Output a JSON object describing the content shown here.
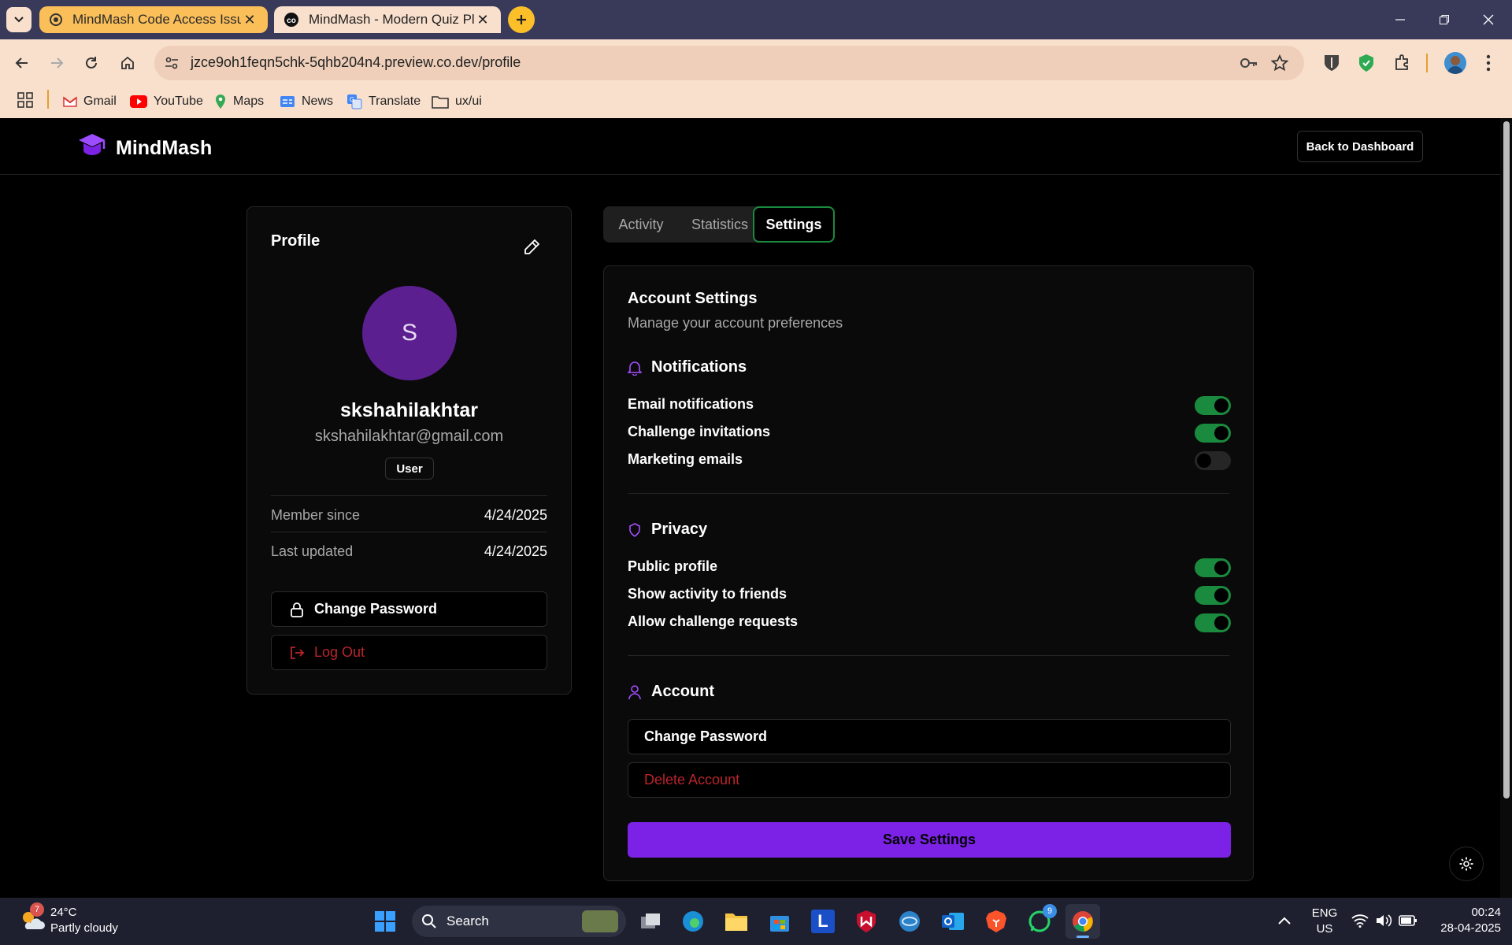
{
  "browser": {
    "tabs": [
      {
        "title": "MindMash Code Access Issue",
        "active": false
      },
      {
        "title": "MindMash - Modern Quiz Platf",
        "active": true
      }
    ],
    "url": "jzce9oh1feqn5chk-5qhb204n4.preview.co.dev/profile",
    "bookmarks": [
      "Gmail",
      "YouTube",
      "Maps",
      "News",
      "Translate",
      "ux/ui"
    ]
  },
  "app": {
    "name": "MindMash",
    "back_button": "Back to Dashboard",
    "accent": "#7c22e6"
  },
  "profile": {
    "title": "Profile",
    "avatar_letter": "S",
    "username": "skshahilakhtar",
    "email": "skshahilakhtar@gmail.com",
    "role": "User",
    "member_since_label": "Member since",
    "member_since": "4/24/2025",
    "last_updated_label": "Last updated",
    "last_updated": "4/24/2025",
    "change_password": "Change Password",
    "logout": "Log Out"
  },
  "tabs": {
    "activity": "Activity",
    "statistics": "Statistics",
    "settings": "Settings",
    "active": "settings"
  },
  "settings": {
    "title": "Account Settings",
    "subtitle": "Manage your account preferences",
    "notifications": {
      "heading": "Notifications",
      "items": [
        {
          "label": "Email notifications",
          "on": true
        },
        {
          "label": "Challenge invitations",
          "on": true
        },
        {
          "label": "Marketing emails",
          "on": false
        }
      ]
    },
    "privacy": {
      "heading": "Privacy",
      "items": [
        {
          "label": "Public profile",
          "on": true
        },
        {
          "label": "Show activity to friends",
          "on": true
        },
        {
          "label": "Allow challenge requests",
          "on": true
        }
      ]
    },
    "account": {
      "heading": "Account",
      "change_password": "Change Password",
      "delete_account": "Delete Account"
    },
    "save": "Save Settings"
  },
  "taskbar": {
    "weather_temp": "24°C",
    "weather_desc": "Partly cloudy",
    "weather_badge": "7",
    "search": "Search",
    "lang1": "ENG",
    "lang2": "US",
    "time": "00:24",
    "date": "28-04-2025",
    "whatsapp_badge": "9"
  }
}
